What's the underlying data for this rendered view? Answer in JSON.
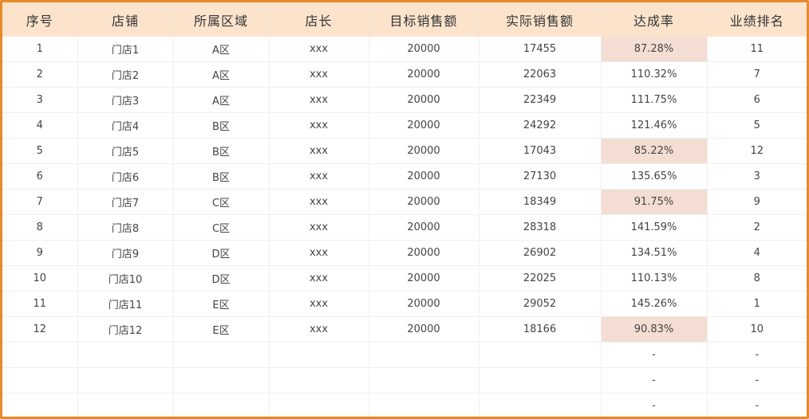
{
  "headers": [
    "序号",
    "店铺",
    "所属区域",
    "店长",
    "目标销售额",
    "实际销售额",
    "达成率",
    "业绩排名"
  ],
  "rows": [
    [
      "1",
      "门店1",
      "A区",
      "xxx",
      "20000",
      "17455",
      "87.28%",
      "11"
    ],
    [
      "2",
      "门店2",
      "A区",
      "xxx",
      "20000",
      "22063",
      "110.32%",
      "7"
    ],
    [
      "3",
      "门店3",
      "A区",
      "xxx",
      "20000",
      "22349",
      "111.75%",
      "6"
    ],
    [
      "4",
      "门店4",
      "B区",
      "xxx",
      "20000",
      "24292",
      "121.46%",
      "5"
    ],
    [
      "5",
      "门店5",
      "B区",
      "xxx",
      "20000",
      "17043",
      "85.22%",
      "12"
    ],
    [
      "6",
      "门店6",
      "B区",
      "xxx",
      "20000",
      "27130",
      "135.65%",
      "3"
    ],
    [
      "7",
      "门店7",
      "C区",
      "xxx",
      "20000",
      "18349",
      "91.75%",
      "9"
    ],
    [
      "8",
      "门店8",
      "C区",
      "xxx",
      "20000",
      "28318",
      "141.59%",
      "2"
    ],
    [
      "9",
      "门店9",
      "D区",
      "xxx",
      "20000",
      "26902",
      "134.51%",
      "4"
    ],
    [
      "10",
      "门店10",
      "D区",
      "xxx",
      "20000",
      "22025",
      "110.13%",
      "8"
    ],
    [
      "11",
      "门店11",
      "E区",
      "xxx",
      "20000",
      "29052",
      "145.26%",
      "1"
    ],
    [
      "12",
      "门店12",
      "E区",
      "xxx",
      "20000",
      "18166",
      "90.83%",
      "10"
    ],
    [
      "",
      "",
      "",
      "",
      "",
      "",
      "-",
      "-"
    ],
    [
      "",
      "",
      "",
      "",
      "",
      "",
      "-",
      "-"
    ],
    [
      "",
      "",
      "",
      "",
      "",
      "",
      "-",
      "-"
    ]
  ],
  "highlight_color": "#F4DDD2",
  "highlight_threshold_percent": 100
}
